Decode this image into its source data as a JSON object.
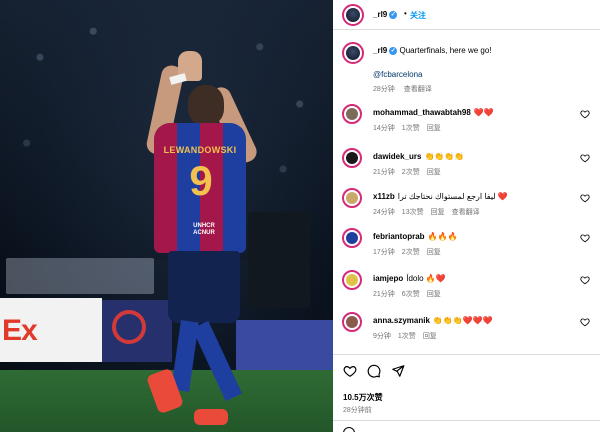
{
  "photo": {
    "jersey_name": "LEWANDOWSKI",
    "jersey_number": "9",
    "sponsor": "UNHCR ACNUR",
    "board_text": "Ex"
  },
  "header": {
    "username": "_rl9",
    "separator": "•",
    "follow_label": "关注"
  },
  "caption": {
    "username": "_rl9",
    "text": "Quarterfinals, here we go!",
    "mention": "@fcbarcelona",
    "time": "28分钟",
    "view_translation": "查看翻译"
  },
  "comments": [
    {
      "username": "mohammad_thawabtah98",
      "text": "❤️❤️",
      "time": "14分钟",
      "likes": "1次赞",
      "reply": "回复",
      "translate": "",
      "avatar_color": "#7a6b5a"
    },
    {
      "username": "dawidek_urs",
      "text": "👏👏👏👏",
      "time": "21分钟",
      "likes": "2次赞",
      "reply": "回复",
      "translate": "",
      "avatar_color": "#1a1a1a"
    },
    {
      "username": "x11zb",
      "text": "ليفا ارجع لمستواك نحتاجك ترا ❤️",
      "time": "24分钟",
      "likes": "13次赞",
      "reply": "回复",
      "translate": "查看翻译",
      "avatar_color": "#c8a96b"
    },
    {
      "username": "febriantoprab",
      "text": "🔥🔥🔥",
      "time": "17分钟",
      "likes": "2次赞",
      "reply": "回复",
      "translate": "",
      "avatar_color": "#1f3fa0"
    },
    {
      "username": "iamjepo",
      "text": "Ídolo 🔥❤️",
      "time": "21分钟",
      "likes": "6次赞",
      "reply": "回复",
      "translate": "",
      "avatar_color": "#e0c24a"
    },
    {
      "username": "anna.szymanik",
      "text": "👏👏👏❤️❤️❤️",
      "time": "9分钟",
      "likes": "1次赞",
      "reply": "回复",
      "translate": "",
      "avatar_color": "#8a5a4a"
    }
  ],
  "likes_count": "10.5万次赞",
  "post_time": "28分钟前",
  "colors": {
    "accent": "#0095f6",
    "verified": "#3897f0",
    "ring": "#d62976",
    "muted": "#737373"
  }
}
